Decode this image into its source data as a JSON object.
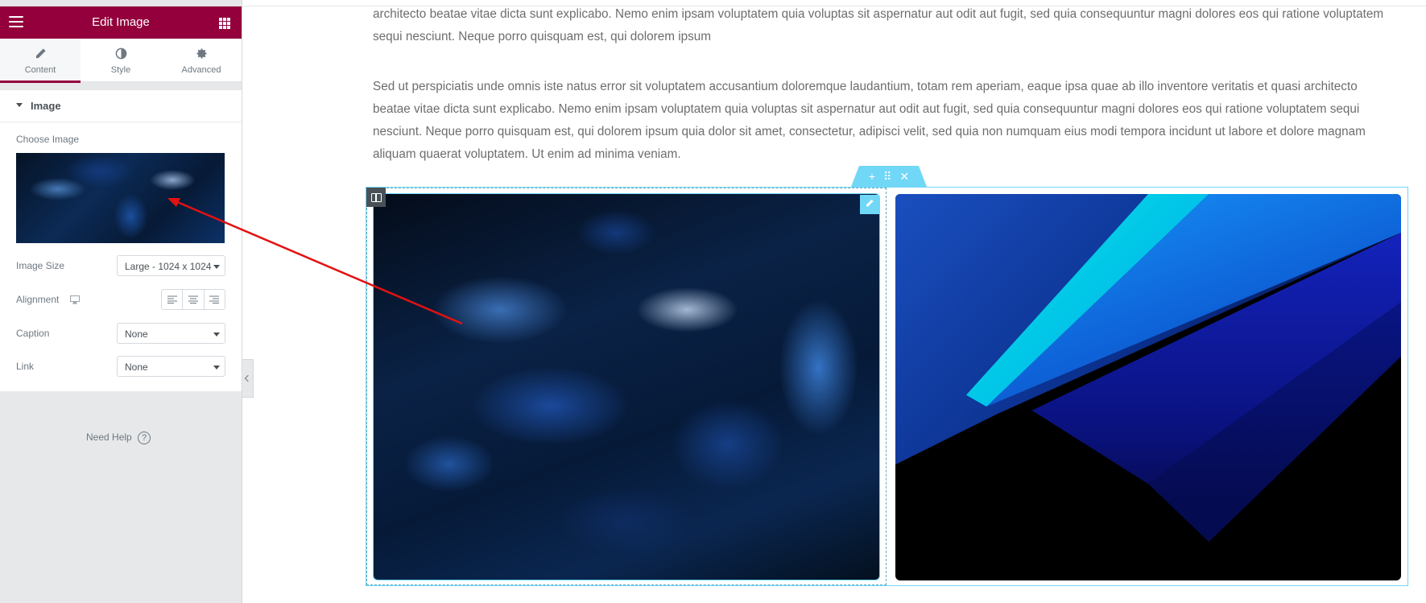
{
  "panel": {
    "title": "Edit Image",
    "tabs": [
      {
        "label": "Content",
        "icon": "pencil-icon",
        "active": true
      },
      {
        "label": "Style",
        "icon": "half-circle-icon",
        "active": false
      },
      {
        "label": "Advanced",
        "icon": "gear-icon",
        "active": false
      }
    ],
    "section_title": "Image",
    "choose_image_label": "Choose Image",
    "image_size": {
      "label": "Image Size",
      "value": "Large - 1024 x 1024"
    },
    "alignment": {
      "label": "Alignment"
    },
    "caption": {
      "label": "Caption",
      "value": "None"
    },
    "link": {
      "label": "Link",
      "value": "None"
    },
    "need_help": "Need Help",
    "help_symbol": "?",
    "accent_color": "#93003c"
  },
  "preview": {
    "paragraph1": "architecto beatae vitae dicta sunt explicabo. Nemo enim ipsam voluptatem quia voluptas sit aspernatur aut odit aut fugit, sed quia consequuntur magni dolores eos qui ratione voluptatem sequi nesciunt. Neque porro quisquam est, qui dolorem ipsum",
    "paragraph2": "Sed ut perspiciatis unde omnis iste natus error sit voluptatem accusantium doloremque laudantium, totam rem aperiam, eaque ipsa quae ab illo inventore veritatis et quasi architecto beatae vitae dicta sunt explicabo. Nemo enim ipsam voluptatem quia voluptas sit aspernatur aut odit aut fugit, sed quia consequuntur magni dolores eos qui ratione voluptatem sequi nesciunt. Neque porro quisquam est, qui dolorem ipsum quia dolor sit amet, consectetur, adipisci velit, sed quia non numquam eius modi tempora incidunt ut labore et dolore magnam aliquam quaerat voluptatem. Ut enim ad minima veniam.",
    "section_handle": {
      "add": "+",
      "move": "⠿",
      "delete": "✕"
    },
    "selection_color": "#71d7f7"
  }
}
